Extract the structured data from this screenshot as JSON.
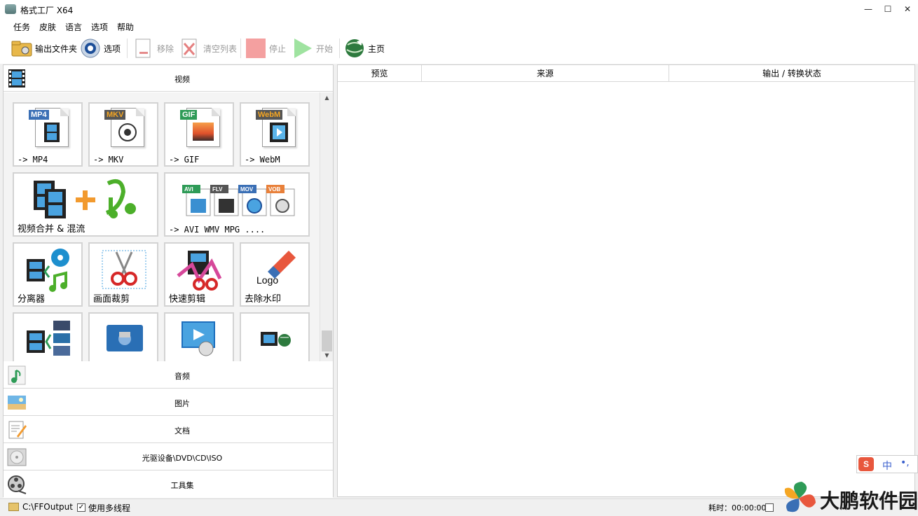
{
  "window": {
    "title": "格式工厂 X64",
    "minimize": "—",
    "maximize": "☐",
    "close": "✕"
  },
  "menu": [
    "任务",
    "皮肤",
    "语言",
    "选项",
    "帮助"
  ],
  "toolbar": {
    "output_folder": "输出文件夹",
    "options": "选项",
    "remove": "移除",
    "clear_list": "清空列表",
    "stop": "停止",
    "start": "开始",
    "home": "主页"
  },
  "categories": {
    "video": "视频",
    "audio": "音频",
    "image": "图片",
    "document": "文档",
    "disc": "光驱设备\\DVD\\CD\\ISO",
    "tools": "工具集"
  },
  "video_tiles": [
    {
      "label": "-> MP4",
      "badge": "MP4"
    },
    {
      "label": "-> MKV",
      "badge": "MKV"
    },
    {
      "label": "-> GIF",
      "badge": "GIF"
    },
    {
      "label": "-> WebM",
      "badge": "WebM"
    },
    {
      "label": "视频合并 & 混流"
    },
    {
      "label": "-> AVI WMV MPG ....",
      "badges": [
        "AVI",
        "FLV",
        "MOV",
        "VOB"
      ]
    },
    {
      "label": "分离器"
    },
    {
      "label": "画面裁剪"
    },
    {
      "label": "快速剪辑"
    },
    {
      "label": "去除水印",
      "logo_text": "Logo"
    },
    {
      "label": ""
    },
    {
      "label": ""
    },
    {
      "label": ""
    },
    {
      "label": ""
    }
  ],
  "task_columns": [
    "预览",
    "来源",
    "输出 / 转换状态"
  ],
  "status": {
    "output_path": "C:\\FFOutput",
    "multithread_label": "使用多线程",
    "multithread_checked": "✓",
    "elapsed": "耗时：00:00:00"
  },
  "ime": {
    "logo": "S",
    "mode": "中",
    "punct": "•,"
  },
  "watermark_text": "大鹏软件园",
  "colors": {
    "mp4": "#3a6fb5",
    "mkv": "#555555",
    "gif": "#2e9b57",
    "webm": "#555555",
    "webm_text": "#f5a623"
  }
}
